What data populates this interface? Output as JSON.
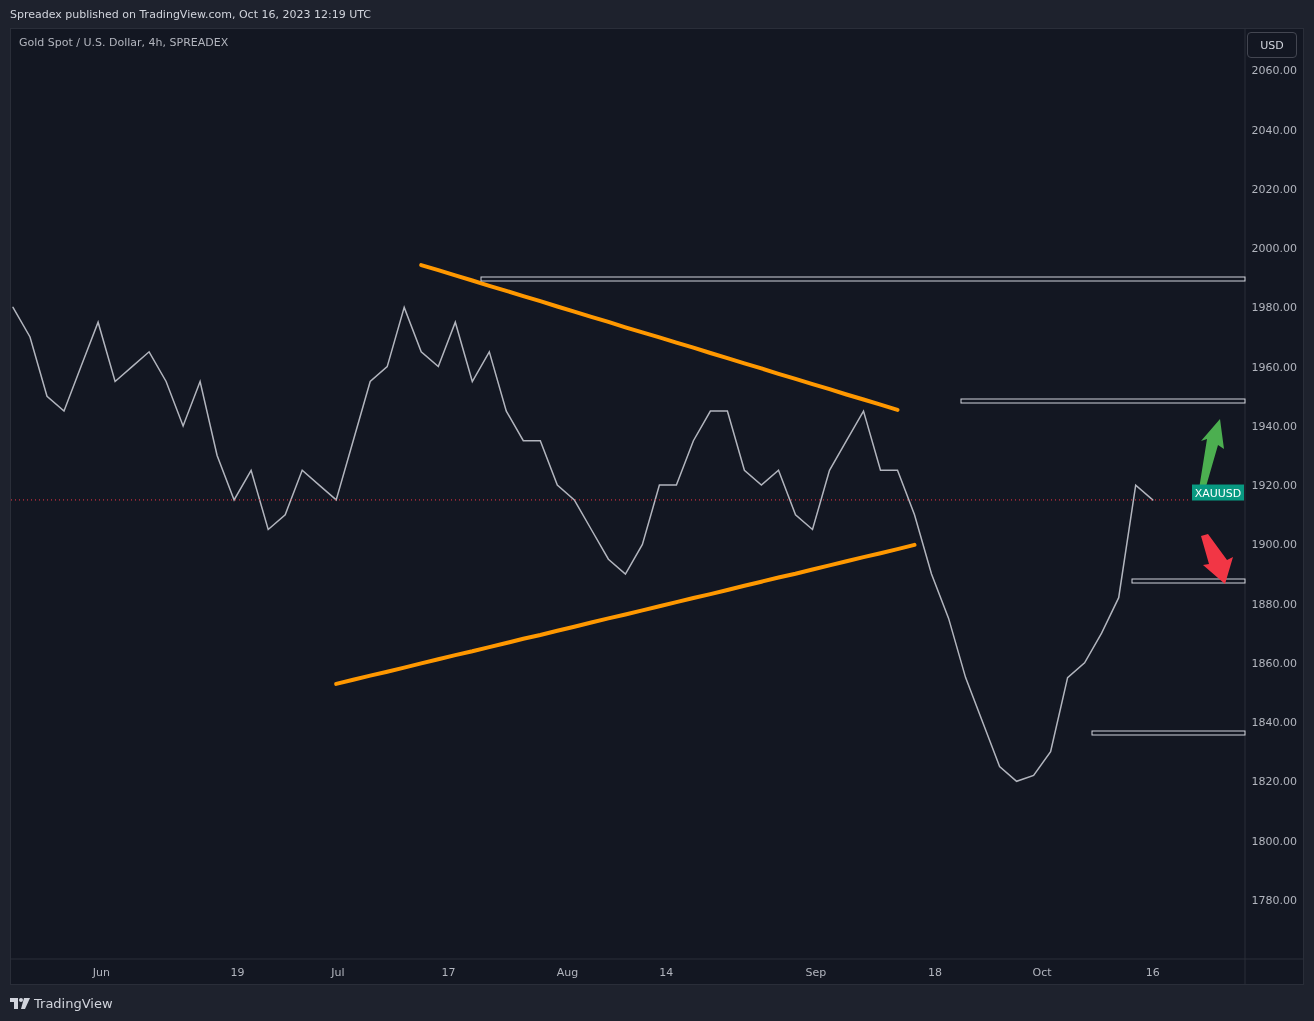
{
  "header": {
    "text": "Spreadex published on TradingView.com, Oct 16, 2023 12:19 UTC"
  },
  "chart": {
    "title": "Gold Spot / U.S. Dollar, 4h, SPREADEX",
    "currency_button": "USD",
    "time_axis": [
      "Jun",
      "19",
      "Jul",
      "17",
      "Aug",
      "14",
      "Sep",
      "18",
      "Oct",
      "16"
    ],
    "chart_data": {
      "type": "line",
      "series": [
        {
          "name": "XAUUSD",
          "color": "#b2b5be",
          "values": [
            1980,
            1970,
            1950,
            1945,
            1960,
            1975,
            1955,
            1960,
            1965,
            1955,
            1940,
            1955,
            1930,
            1915,
            1925,
            1905,
            1910,
            1925,
            1920,
            1915,
            1935,
            1955,
            1960,
            1980,
            1965,
            1960,
            1975,
            1955,
            1965,
            1945,
            1935,
            1935,
            1920,
            1915,
            1905,
            1895,
            1890,
            1900,
            1920,
            1920,
            1935,
            1945,
            1945,
            1925,
            1920,
            1925,
            1910,
            1905,
            1925,
            1935,
            1945,
            1925,
            1925,
            1910,
            1890,
            1875,
            1855,
            1840,
            1825,
            1820,
            1822,
            1830,
            1855,
            1860,
            1870,
            1882,
            1920,
            1915
          ]
        },
        {
          "color": "#ff9800",
          "values": [
            null,
            null,
            null,
            null,
            null,
            null,
            null,
            null,
            null,
            null,
            null,
            null,
            null,
            null,
            null,
            null,
            null,
            null,
            null,
            null,
            null,
            null,
            null,
            null,
            1994.3,
            1992.6,
            1990.8,
            1989.1,
            1987.3,
            1985.6,
            1983.8,
            1982.1,
            1980.3,
            1978.6,
            1976.8,
            1975.1,
            1973.3,
            1971.6,
            1969.9,
            1968.1,
            1966.4,
            1964.6,
            1962.9,
            1961.1,
            1959.4,
            1957.6,
            1955.9,
            1954.1,
            1952.4,
            1950.6,
            1948.9,
            1947.2,
            1945.4,
            null,
            null,
            null,
            null,
            null,
            null,
            null,
            null,
            null,
            null,
            null,
            null,
            null,
            null,
            null
          ]
        },
        {
          "color": "#ff9800",
          "values": [
            null,
            null,
            null,
            null,
            null,
            null,
            null,
            null,
            null,
            null,
            null,
            null,
            null,
            null,
            null,
            null,
            null,
            null,
            null,
            1852.9,
            1854.3,
            1855.7,
            1857.0,
            1858.4,
            1859.8,
            1861.2,
            1862.6,
            1863.9,
            1865.3,
            1866.7,
            1868.1,
            1869.4,
            1870.8,
            1872.2,
            1873.6,
            1875.0,
            1876.3,
            1877.7,
            1879.1,
            1880.5,
            1881.9,
            1883.2,
            1884.6,
            1886.0,
            1887.4,
            1888.8,
            1890.1,
            1891.5,
            1892.9,
            1894.3,
            1895.7,
            1897.0,
            1898.4,
            1899.8,
            null,
            null,
            null,
            null,
            null,
            null,
            null,
            null,
            null,
            null,
            null,
            null,
            null,
            null
          ]
        }
      ],
      "ylim": [
        1760,
        2074
      ],
      "yticks": [
        {
          "value": 2060,
          "label": "2060.00"
        },
        {
          "value": 2040,
          "label": "2040.00"
        },
        {
          "value": 2020,
          "label": "2020.00"
        },
        {
          "value": 2000,
          "label": "2000.00"
        },
        {
          "value": 1980,
          "label": "1980.00"
        },
        {
          "value": 1960,
          "label": "1960.00"
        },
        {
          "value": 1940,
          "label": "1940.00"
        },
        {
          "value": 1920,
          "label": "1920.00"
        },
        {
          "value": 1900,
          "label": "1900.00"
        },
        {
          "value": 1880,
          "label": "1880.00"
        },
        {
          "value": 1860,
          "label": "1860.00"
        },
        {
          "value": 1840,
          "label": "1840.00"
        },
        {
          "value": 1820,
          "label": "1820.00"
        },
        {
          "value": 1800,
          "label": "1800.00"
        },
        {
          "value": 1780,
          "label": "1780.00"
        }
      ]
    }
  },
  "footer": {
    "brand": "TradingView"
  }
}
